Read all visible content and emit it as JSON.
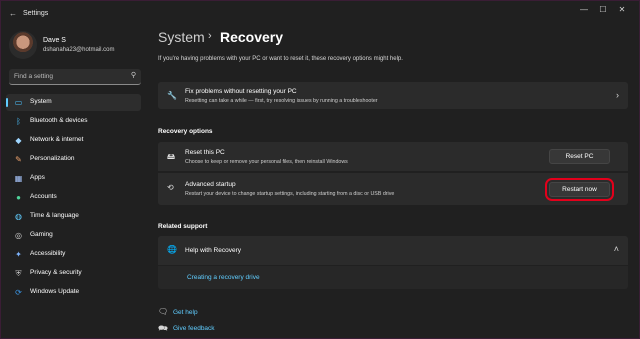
{
  "app": {
    "title": "Settings"
  },
  "profile": {
    "name": "Dave S",
    "email": "dshanaha23@hotmail.com"
  },
  "search": {
    "placeholder": "Find a setting"
  },
  "sidebar": {
    "items": [
      {
        "label": "System",
        "icon": "monitor-icon",
        "color": "#4cc2ff",
        "active": true
      },
      {
        "label": "Bluetooth & devices",
        "icon": "bluetooth-icon",
        "color": "#4cc2ff"
      },
      {
        "label": "Network & internet",
        "icon": "wifi-icon",
        "color": "#9fd6ff"
      },
      {
        "label": "Personalization",
        "icon": "brush-icon",
        "color": "#f0a46e"
      },
      {
        "label": "Apps",
        "icon": "apps-icon",
        "color": "#a9c7ff"
      },
      {
        "label": "Accounts",
        "icon": "person-icon",
        "color": "#4fd39a"
      },
      {
        "label": "Time & language",
        "icon": "globe-clock-icon",
        "color": "#60cdff"
      },
      {
        "label": "Gaming",
        "icon": "gamepad-icon",
        "color": "#d0d0d0"
      },
      {
        "label": "Accessibility",
        "icon": "accessibility-icon",
        "color": "#7fb5ff"
      },
      {
        "label": "Privacy & security",
        "icon": "shield-icon",
        "color": "#b8b8b8"
      },
      {
        "label": "Windows Update",
        "icon": "update-icon",
        "color": "#3c9cf0"
      }
    ]
  },
  "breadcrumb": {
    "root": "System",
    "leaf": "Recovery"
  },
  "intro": "If you're having problems with your PC or want to reset it, these recovery options might help.",
  "fix_card": {
    "title": "Fix problems without resetting your PC",
    "subtitle": "Resetting can take a while — first, try resolving issues by running a troubleshooter"
  },
  "recovery_options": {
    "heading": "Recovery options",
    "reset": {
      "title": "Reset this PC",
      "subtitle": "Choose to keep or remove your personal files, then reinstall Windows",
      "button": "Reset PC"
    },
    "advanced": {
      "title": "Advanced startup",
      "subtitle": "Restart your device to change startup settings, including starting from a disc or USB drive",
      "button": "Restart now"
    }
  },
  "related_support": {
    "heading": "Related support",
    "help_title": "Help with Recovery",
    "link": "Creating a recovery drive"
  },
  "footer": {
    "get_help": "Get help",
    "give_feedback": "Give feedback"
  },
  "colors": {
    "accent": "#60cdff",
    "highlight": "#e3001b"
  }
}
